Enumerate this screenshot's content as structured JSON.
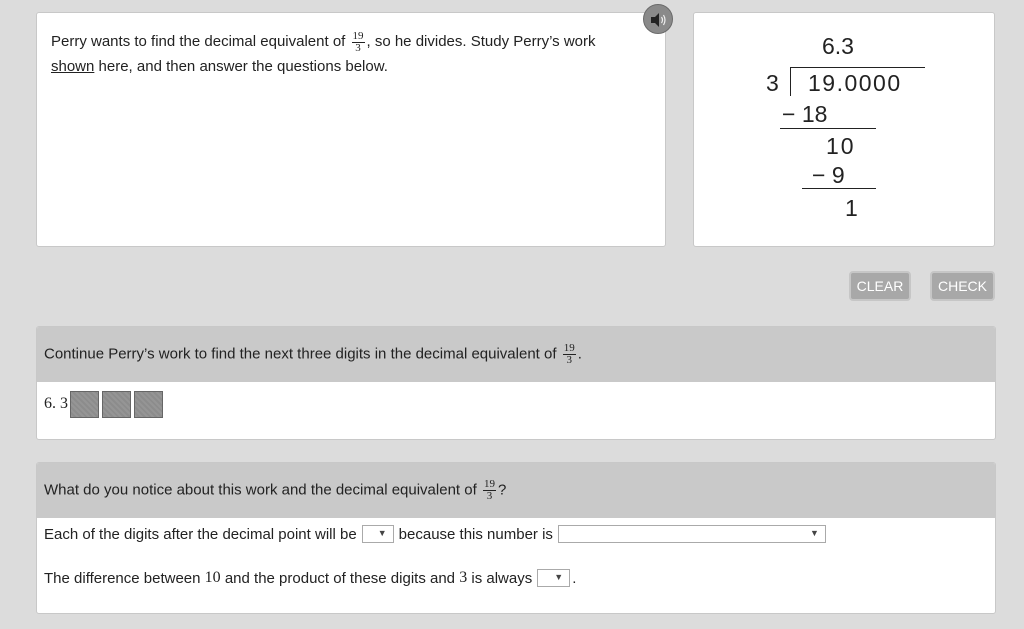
{
  "problem": {
    "text_before": "Perry wants to find the decimal equivalent of",
    "fraction": {
      "numerator": "19",
      "denominator": "3"
    },
    "text_after": ", so he divides. Study Perry’s work",
    "link_text": "shown",
    "text_end": "here, and then answer the questions below."
  },
  "audio": {
    "icon": "speaker-icon"
  },
  "division": {
    "quotient": "6.3",
    "divisor": "3",
    "dividend": "19.0000",
    "step1_subtract": "− 18",
    "step1_remainder": "10",
    "step2_subtract": "− 9",
    "step2_remainder": "1"
  },
  "buttons": {
    "clear": "CLEAR",
    "check": "CHECK"
  },
  "question1": {
    "prompt": "Continue Perry’s work to find the next three digits in the decimal equivalent of",
    "fraction": {
      "numerator": "19",
      "denominator": "3"
    },
    "prompt_end": ".",
    "answer_prefix": "6. 3",
    "digit_boxes": [
      "",
      "",
      ""
    ]
  },
  "question2": {
    "prompt": "What do you notice about this work and the decimal equivalent of",
    "fraction": {
      "numerator": "19",
      "denominator": "3"
    },
    "prompt_end": "?",
    "sentence1_a": "Each of the digits after the decimal point will be",
    "sentence1_b": "because this number is",
    "sentence2_a": "The difference between",
    "sentence2_num1": "10",
    "sentence2_b": "and the product of these digits and",
    "sentence2_num2": "3",
    "sentence2_c": "is always",
    "sentence2_end": "."
  },
  "colors": {
    "header_bg": "#c9c9c9",
    "button_bg": "#a8a8a8",
    "digit_box": "#8c8c8c"
  }
}
